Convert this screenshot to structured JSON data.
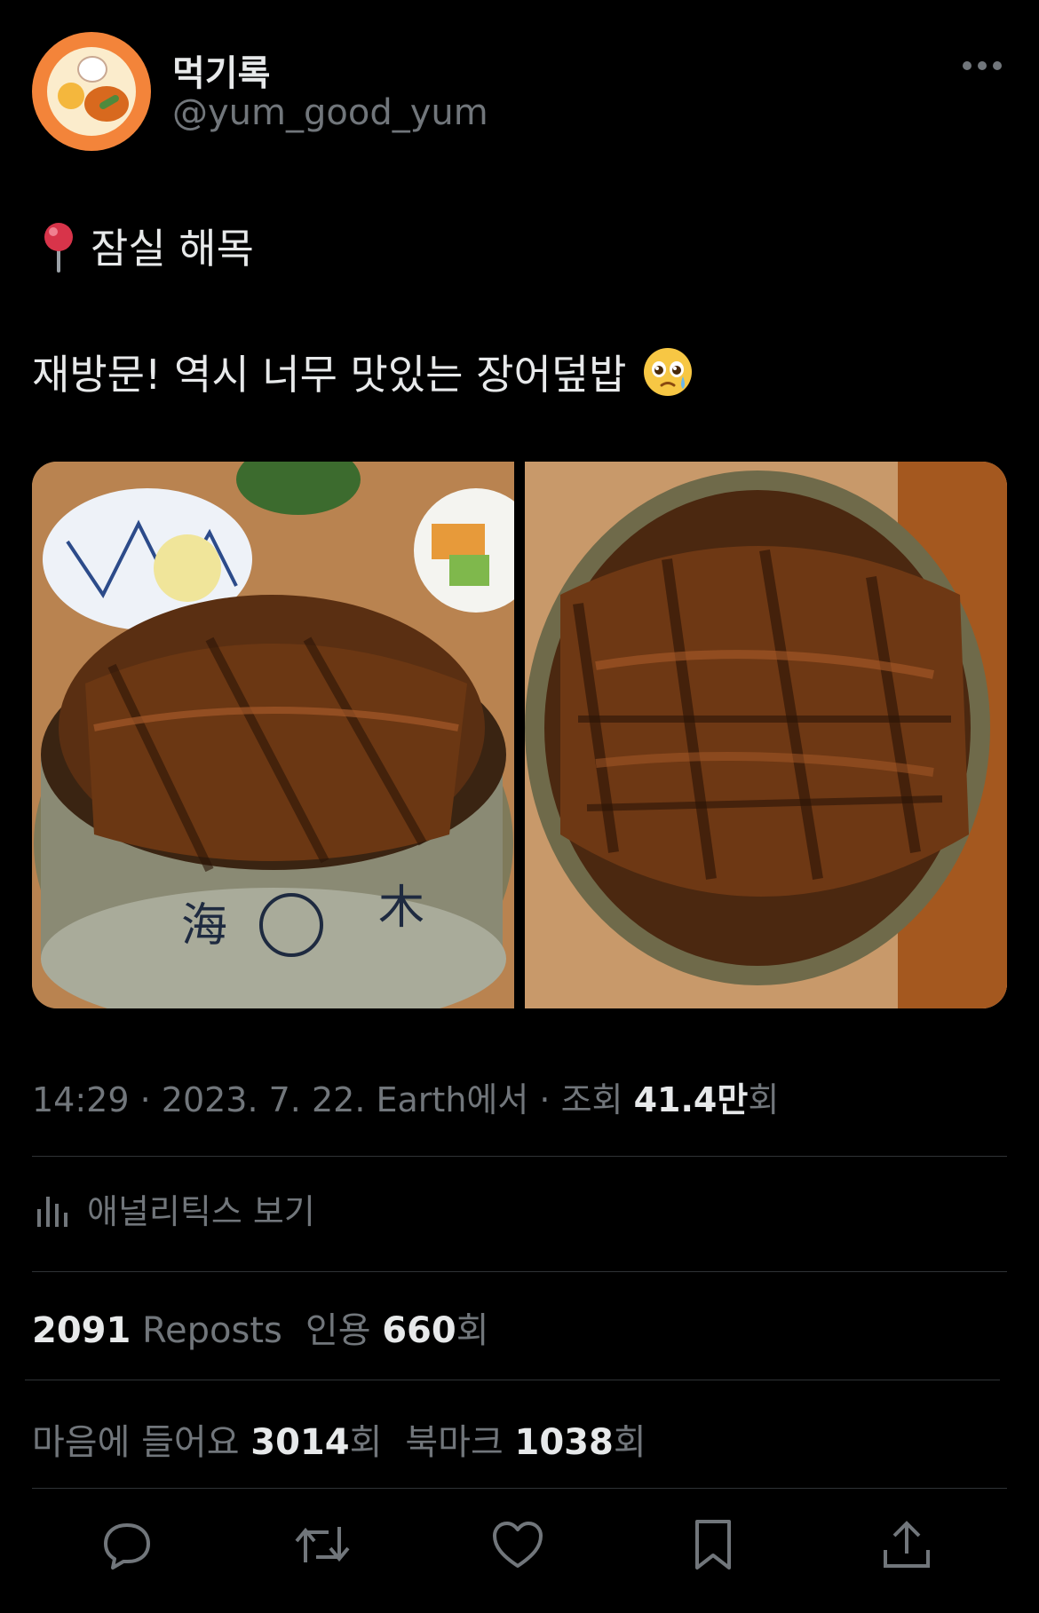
{
  "author": {
    "display_name": "먹기록",
    "handle": "@yum_good_yum"
  },
  "tweet": {
    "line1": "잠실 해목",
    "line2": "재방문! 역시 너무 맛있는 장어덮밥",
    "icons": [
      "pin-icon",
      "pleading-face-emoji"
    ]
  },
  "media": {
    "count": 2,
    "left_bowl_text_1": "海",
    "left_bowl_text_2": "木"
  },
  "meta": {
    "time": "14:29",
    "date": "2023. 7. 22.",
    "source": "Earth에서",
    "views_label": "조회",
    "views_value": "41.4만",
    "views_suffix": "회"
  },
  "analytics": {
    "label": "애널리틱스 보기"
  },
  "stats": {
    "reposts_value": "2091",
    "reposts_label": "Reposts",
    "quotes_label": "인용",
    "quotes_value": "660",
    "quotes_suffix": "회",
    "likes_label": "마음에 들어요",
    "likes_value": "3014",
    "likes_suffix": "회",
    "bookmarks_label": "북마크",
    "bookmarks_value": "1038",
    "bookmarks_suffix": "회"
  },
  "actions": [
    "reply-icon",
    "repost-icon",
    "like-icon",
    "bookmark-icon",
    "share-icon"
  ],
  "colors": {
    "background": "#000000",
    "primary_text": "#e7e9ea",
    "secondary_text": "#71767b",
    "divider": "#2f3336",
    "avatar_ring": "#f3843a"
  }
}
